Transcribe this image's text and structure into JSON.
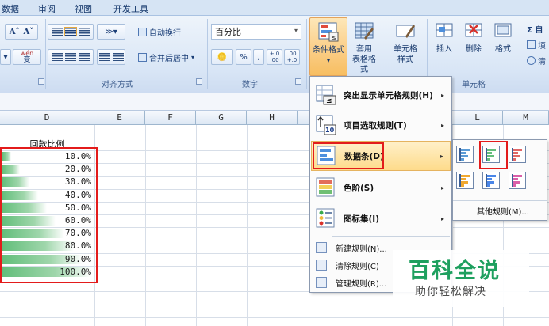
{
  "menu_tabs": [
    "数据",
    "审阅",
    "视图",
    "开发工具"
  ],
  "ribbon": {
    "font_group": {
      "grow_font": "A˄",
      "shrink_font": "A˅",
      "phonetic": "wén",
      "phonetic_sub": "变"
    },
    "align_group": {
      "wrap_text": "自动换行",
      "merge_center": "合并后居中",
      "label": "对齐方式"
    },
    "number_group": {
      "format_value": "百分比",
      "percent": "%",
      "comma": ",",
      "inc_decimal": "+.0 .00",
      "dec_decimal": ".00 +.0",
      "label": "数字"
    },
    "styles_group": {
      "conditional_format": "条件格式",
      "table_format_1": "套用",
      "table_format_2": "表格格式",
      "cell_style_1": "单元格",
      "cell_style_2": "样式"
    },
    "cells_group": {
      "insert": "插入",
      "delete": "删除",
      "format": "格式",
      "label": "单元格"
    },
    "edit_group": {
      "sigma": "Σ 自",
      "fill": "填",
      "clear": "清"
    }
  },
  "sheet": {
    "columns": [
      "D",
      "E",
      "F",
      "G",
      "H",
      "L",
      "M"
    ],
    "header_cell": "回款比例",
    "values": [
      "10.0%",
      "20.0%",
      "30.0%",
      "40.0%",
      "50.0%",
      "60.0%",
      "70.0%",
      "80.0%",
      "90.0%",
      "100.0%"
    ],
    "fill_levels": [
      0.1,
      0.2,
      0.3,
      0.4,
      0.5,
      0.6,
      0.7,
      0.8,
      0.9,
      1.0
    ],
    "bar_color": "#63be7b",
    "highlight_color": "#e31b1b"
  },
  "cf_menu": {
    "highlight_rules": "突出显示单元格规则(H)",
    "top_bottom": "项目选取规则(T)",
    "data_bars": "数据条(D)",
    "color_scales": "色阶(S)",
    "icon_sets": "图标集(I)",
    "new_rule": "新建规则(N)...",
    "clear_rules": "清除规则(C)",
    "manage_rules": "管理规则(R)...",
    "top_bottom_badge": "10"
  },
  "databar_submenu": {
    "colors": [
      "#5b9bd5",
      "#63be7b",
      "#e06666",
      "#f0a830",
      "#4a86e8",
      "#d95fa8"
    ],
    "more_rules": "其他规则(M)..."
  },
  "watermark": {
    "title": "百科全说",
    "subtitle": "助你轻松解决"
  }
}
